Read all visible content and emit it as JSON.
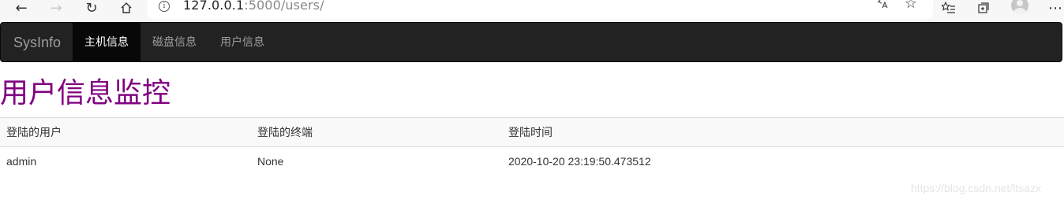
{
  "browser": {
    "url_host": "127.0.0.1",
    "url_path": ":5000/users/"
  },
  "navbar": {
    "brand": "SysInfo",
    "items": [
      {
        "label": "主机信息",
        "active": true
      },
      {
        "label": "磁盘信息",
        "active": false
      },
      {
        "label": "用户信息",
        "active": false
      }
    ]
  },
  "page": {
    "title": "用户信息监控"
  },
  "table": {
    "headers": [
      "登陆的用户",
      "登陆的终端",
      "登陆时间"
    ],
    "rows": [
      [
        "admin",
        "None",
        "2020-10-20 23:19:50.473512"
      ]
    ]
  },
  "watermark": "https://blog.csdn.net/ltsazx",
  "colors": {
    "title": "#800080",
    "navbar_bg": "#222222",
    "navbar_active_bg": "#080808"
  }
}
